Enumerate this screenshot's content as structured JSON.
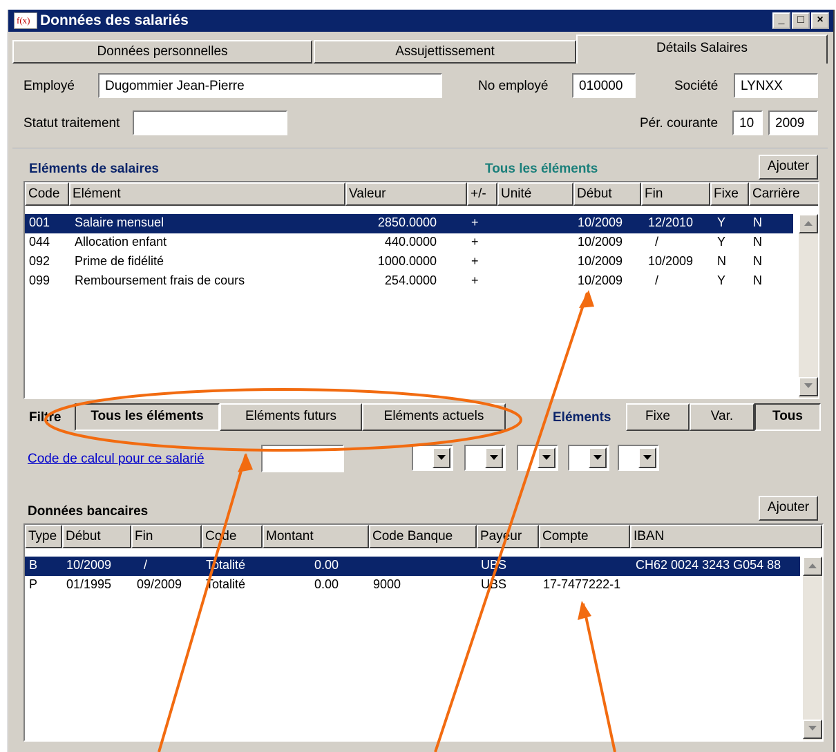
{
  "window": {
    "title": "Données des salariés"
  },
  "tabs": [
    {
      "label": "Données personnelles"
    },
    {
      "label": "Assujettissement"
    },
    {
      "label": "Détails Salaires"
    }
  ],
  "header": {
    "employe_label": "Employé",
    "employe_value": "Dugommier Jean-Pierre",
    "no_employe_label": "No employé",
    "no_employe_value": "010000",
    "societe_label": "Société",
    "societe_value": "LYNXX",
    "statut_label": "Statut traitement",
    "statut_value": "",
    "periode_label": "Pér. courante",
    "periode_month": "10",
    "periode_year": "2009"
  },
  "elements": {
    "title": "Eléments de salaires",
    "filter_status": "Tous les éléments",
    "add_label": "Ajouter",
    "columns": [
      "Code",
      "Elément",
      "Valeur",
      "+/-",
      "Unité",
      "Début",
      "Fin",
      "Fixe",
      "Carrière"
    ],
    "rows": [
      {
        "code": "001",
        "element": "Salaire mensuel",
        "valeur": "2850.0000",
        "sign": "+",
        "unite": "",
        "debut": "10/2009",
        "fin": "12/2010",
        "fixe": "Y",
        "carriere": "N"
      },
      {
        "code": "044",
        "element": "Allocation enfant",
        "valeur": "440.0000",
        "sign": "+",
        "unite": "",
        "debut": "10/2009",
        "fin": "/",
        "fixe": "Y",
        "carriere": "N"
      },
      {
        "code": "092",
        "element": "Prime de fidélité",
        "valeur": "1000.0000",
        "sign": "+",
        "unite": "",
        "debut": "10/2009",
        "fin": "10/2009",
        "fixe": "N",
        "carriere": "N"
      },
      {
        "code": "099",
        "element": "Remboursement frais de cours",
        "valeur": "254.0000",
        "sign": "+",
        "unite": "",
        "debut": "10/2009",
        "fin": "/",
        "fixe": "Y",
        "carriere": "N"
      }
    ]
  },
  "filtre": {
    "label": "Filtre",
    "tous": "Tous les éléments",
    "futurs": "Eléments futurs",
    "actuels": "Eléments actuels",
    "elements_label": "Eléments",
    "fixe": "Fixe",
    "var": "Var.",
    "tous_short": "Tous"
  },
  "calcul": {
    "link": "Code de calcul pour ce salarié",
    "value": ""
  },
  "bank": {
    "title": "Données bancaires",
    "add_label": "Ajouter",
    "columns": [
      "Type",
      "Début",
      "Fin",
      "Code",
      "Montant",
      "Code Banque",
      "Payeur",
      "Compte",
      "IBAN"
    ],
    "rows": [
      {
        "type": "B",
        "debut": "10/2009",
        "fin": "/",
        "code": "Totalité",
        "montant": "0.00",
        "code_banque": "",
        "payeur": "UBS",
        "compte": "",
        "iban": "CH62 0024 3243 G054 88"
      },
      {
        "type": "P",
        "debut": "01/1995",
        "fin": "09/2009",
        "code": "Totalité",
        "montant": "0.00",
        "code_banque": "9000",
        "payeur": "UBS",
        "compte": "17-7477222-1",
        "iban": ""
      }
    ]
  },
  "colors": {
    "selection": "#0a246a",
    "annotation": "#f26b10",
    "status_text": "#1a7f7a"
  }
}
